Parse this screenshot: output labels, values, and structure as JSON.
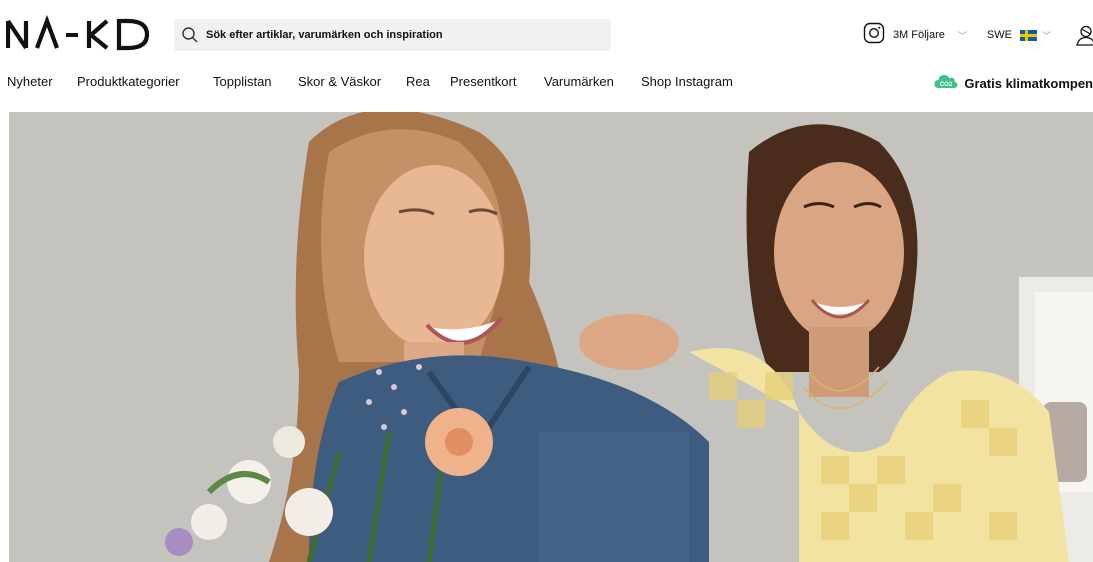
{
  "brand": {
    "logo_text": "NA-KD"
  },
  "search": {
    "placeholder": "Sök efter artiklar, varumärken och inspiration",
    "icon": "search-icon"
  },
  "header": {
    "instagram": {
      "icon": "instagram-icon",
      "label": "3M Följare"
    },
    "country": {
      "code": "SWE",
      "flag": "sweden-flag"
    },
    "account_icon": "account-icon"
  },
  "nav": {
    "items": [
      {
        "label": "Nyheter"
      },
      {
        "label": "Produktkategorier"
      },
      {
        "label": "Topplistan"
      },
      {
        "label": "Skor & Väskor"
      },
      {
        "label": "Rea"
      },
      {
        "label": "Presentkort"
      },
      {
        "label": "Varumärken"
      },
      {
        "label": "Shop Instagram"
      }
    ],
    "climate": {
      "badge": "CO2",
      "label": "Gratis klimatkompen"
    }
  },
  "colors": {
    "accent_green": "#3cc28a",
    "text": "#111111",
    "search_bg": "#f1f1f1"
  }
}
